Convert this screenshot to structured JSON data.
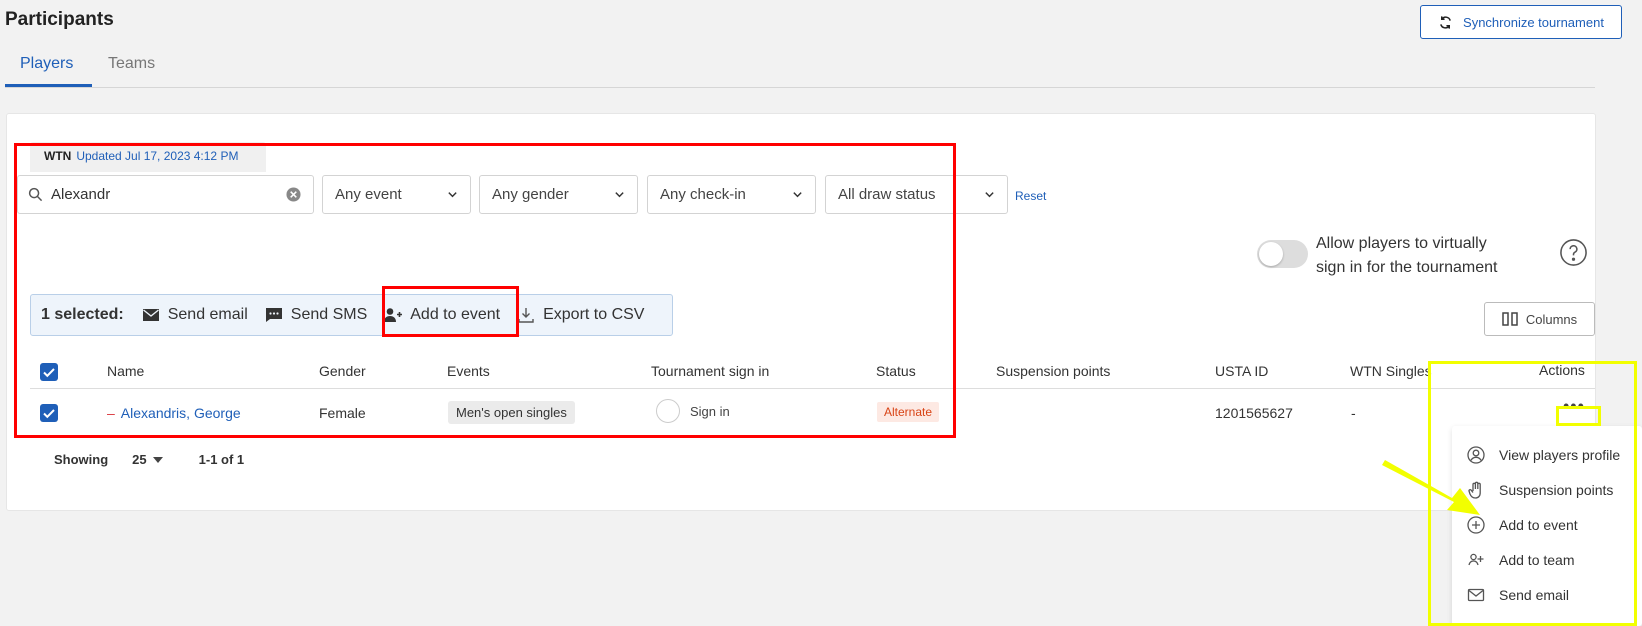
{
  "header": {
    "title": "Participants",
    "sync_label": "Synchronize tournament"
  },
  "tabs": [
    {
      "label": "Players"
    },
    {
      "label": "Teams"
    }
  ],
  "wtn": {
    "label": "WTN",
    "updated": "Updated Jul 17, 2023 4:12 PM"
  },
  "filters": {
    "search_value": "Alexandr",
    "event": "Any event",
    "gender": "Any gender",
    "checkin": "Any check-in",
    "draw_status": "All draw status",
    "reset_label": "Reset"
  },
  "toggle": {
    "label": "Allow players to virtually sign in for the tournament",
    "on": false
  },
  "columns_label": "Columns",
  "bulk": {
    "selected": "1 selected:",
    "actions": [
      {
        "label": "Send email",
        "icon": "envelope-icon"
      },
      {
        "label": "Send SMS",
        "icon": "sms-icon"
      },
      {
        "label": "Add to event",
        "icon": "user-plus-icon"
      },
      {
        "label": "Export to CSV",
        "icon": "download-icon"
      }
    ]
  },
  "table": {
    "headers": [
      "Name",
      "Gender",
      "Events",
      "Tournament sign in",
      "Status",
      "Suspension points",
      "USTA ID",
      "WTN Singles",
      "Actions"
    ],
    "rows": [
      {
        "dash": "–",
        "name": "Alexandris, George",
        "gender": "Female",
        "event": "Men's open singles",
        "signin": "Sign in",
        "status": "Alternate",
        "usta_id": "1201565627",
        "wtn": "-",
        "more": "•••"
      }
    ]
  },
  "pager": {
    "label": "Showing",
    "per_page": "25",
    "range": "1-1 of 1"
  },
  "actions_menu": [
    {
      "label": "View players profile",
      "icon": "user-circle-icon"
    },
    {
      "label": "Suspension points",
      "icon": "hand-icon"
    },
    {
      "label": "Add to event",
      "icon": "plus-circle-icon"
    },
    {
      "label": "Add to team",
      "icon": "users-plus-icon"
    },
    {
      "label": "Send email",
      "icon": "envelope-icon"
    }
  ],
  "colors": {
    "accent": "#1f5fb8",
    "annotation_red": "#ff0000",
    "annotation_yellow": "#f2ff00",
    "status_alternate": "#d84315"
  }
}
